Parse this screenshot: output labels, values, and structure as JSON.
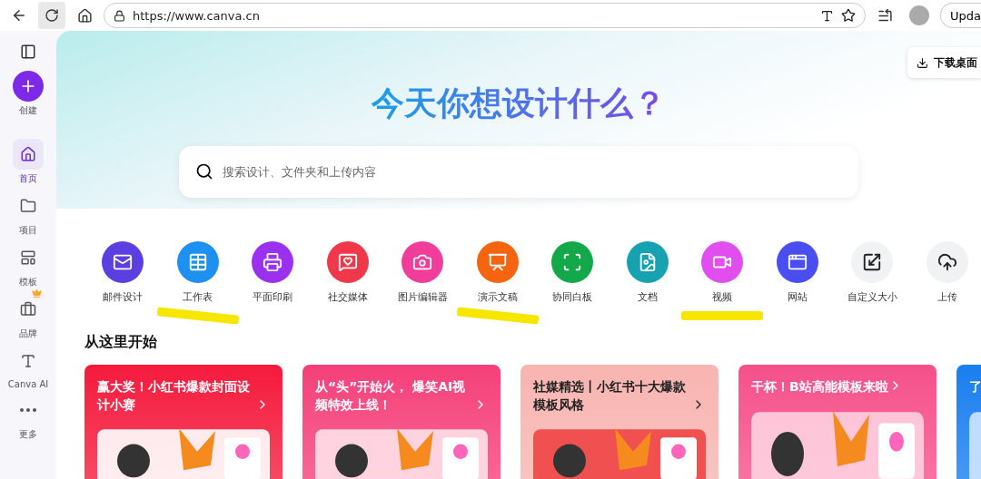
{
  "browser": {
    "url": "https://www.canva.cn",
    "update_button": "Upda"
  },
  "sidebar": {
    "items": [
      {
        "label": "创建",
        "kind": "create"
      },
      {
        "label": "首页",
        "kind": "nav",
        "selected": true
      },
      {
        "label": "项目",
        "kind": "nav",
        "selected": false
      },
      {
        "label": "模板",
        "kind": "nav",
        "selected": false
      },
      {
        "label": "品牌",
        "kind": "nav",
        "selected": false,
        "badge": true
      },
      {
        "label": "Canva AI",
        "kind": "nav",
        "selected": false
      },
      {
        "label": "更多",
        "kind": "nav",
        "selected": false
      }
    ]
  },
  "download_button": "下载桌面",
  "hero": {
    "title": "今天你想设计什么？",
    "search": {
      "placeholder": "搜索设计、文件夹和上传内容"
    }
  },
  "design_types": [
    {
      "label": "邮件设计",
      "color": "#5b3fe0",
      "kind": "filled",
      "highlighted": false
    },
    {
      "label": "工作表",
      "color": "#1e90f0",
      "kind": "filled",
      "highlighted": true
    },
    {
      "label": "平面印刷",
      "color": "#9b30f0",
      "kind": "filled",
      "highlighted": false
    },
    {
      "label": "社交媒体",
      "color": "#f0384a",
      "kind": "filled",
      "highlighted": false
    },
    {
      "label": "图片编辑器",
      "color": "#f03c9a",
      "kind": "filled",
      "highlighted": false
    },
    {
      "label": "演示文稿",
      "color": "#f5650f",
      "kind": "filled",
      "highlighted": true
    },
    {
      "label": "协同白板",
      "color": "#13a84a",
      "kind": "filled",
      "highlighted": false
    },
    {
      "label": "文档",
      "color": "#17a2b0",
      "kind": "filled",
      "highlighted": false
    },
    {
      "label": "视频",
      "color": "#e04ef0",
      "kind": "filled",
      "highlighted": true
    },
    {
      "label": "网站",
      "color": "#4a4ef0",
      "kind": "filled",
      "highlighted": false
    },
    {
      "label": "自定义大小",
      "color": "#f1f2f4",
      "kind": "plain",
      "highlighted": false
    },
    {
      "label": "上传",
      "color": "#f1f2f4",
      "kind": "plain",
      "highlighted": false
    }
  ],
  "section": {
    "title": "从这里开始",
    "cards": [
      {
        "title": "赢大奖！小红书爆款封面设计小赛",
        "color": "#f51a3c",
        "kind": "light"
      },
      {
        "title": "从“头”开始火， 爆笑AI视频特效上线！",
        "color": "#f5407a",
        "kind": "light"
      },
      {
        "title": "社媒精选丨小红书十大爆款模板风格",
        "color": "#f8b4b0",
        "kind": "dark"
      },
      {
        "title": "干杯！B站高能模板来啦",
        "color": "#f5508a",
        "kind": "light"
      },
      {
        "title": "了",
        "color": "#1a7ef0",
        "kind": "partial"
      }
    ]
  }
}
